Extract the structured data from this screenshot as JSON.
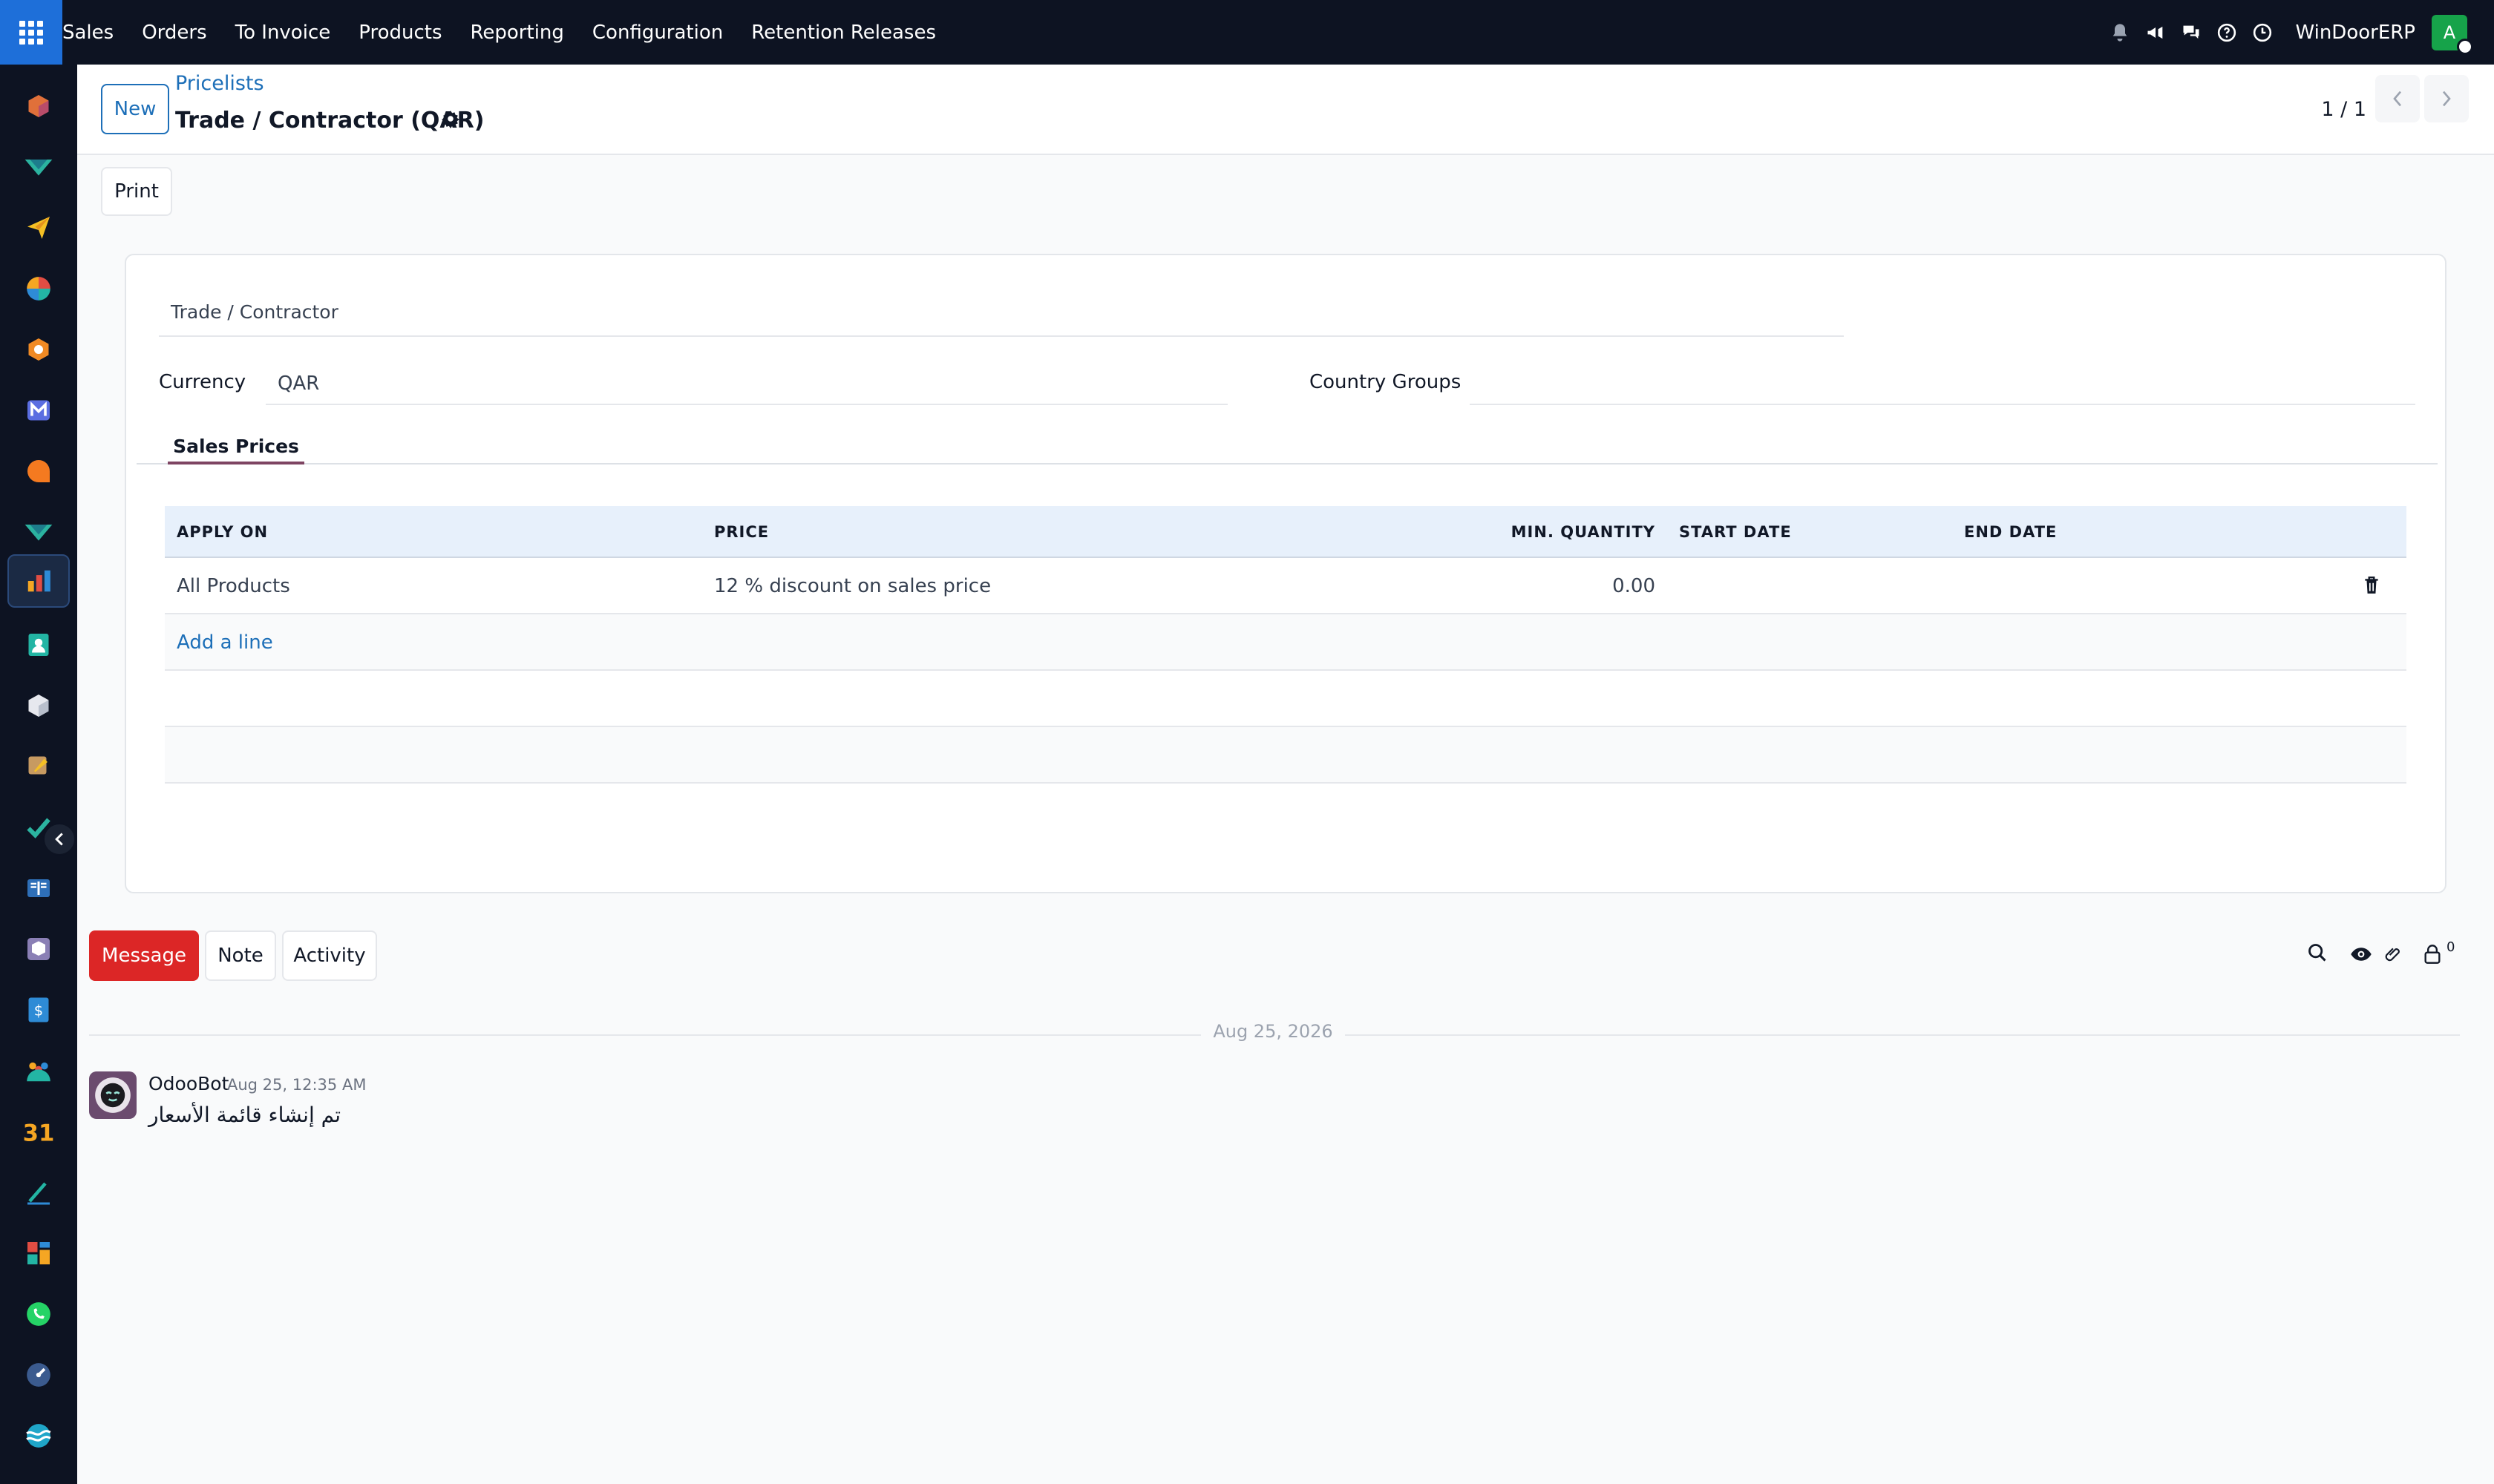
{
  "navbar": {
    "menu": [
      "Sales",
      "Orders",
      "To Invoice",
      "Products",
      "Reporting",
      "Configuration",
      "Retention Releases"
    ],
    "company": "WinDoorERP",
    "avatar_initial": "A",
    "accent_color": "#1e6fd9"
  },
  "control_panel": {
    "new_label": "New",
    "breadcrumb": "Pricelists",
    "title": "Trade / Contractor (QAR)",
    "pager": "1 / 1"
  },
  "actions": {
    "print_label": "Print"
  },
  "form": {
    "name": "Trade / Contractor",
    "currency_label": "Currency",
    "currency_value": "QAR",
    "country_groups_label": "Country Groups",
    "country_groups_value": ""
  },
  "tabs": [
    {
      "label": "Sales Prices",
      "active": true
    }
  ],
  "table": {
    "headers": [
      "APPLY ON",
      "PRICE",
      "MIN. QUANTITY",
      "START DATE",
      "END DATE"
    ],
    "rows": [
      {
        "apply_on": "All Products",
        "price": "12 % discount on sales price",
        "min_qty": "0.00",
        "start_date": "",
        "end_date": ""
      }
    ],
    "add_line": "Add a line"
  },
  "chatter": {
    "message_label": "Message",
    "note_label": "Note",
    "activity_label": "Activity",
    "follower_count": "0",
    "date_separator": "Aug 25, 2026",
    "messages": [
      {
        "author": "OdooBot",
        "date": "Aug 25, 12:35 AM",
        "body": "تم إنشاء قائمة الأسعار"
      }
    ]
  }
}
